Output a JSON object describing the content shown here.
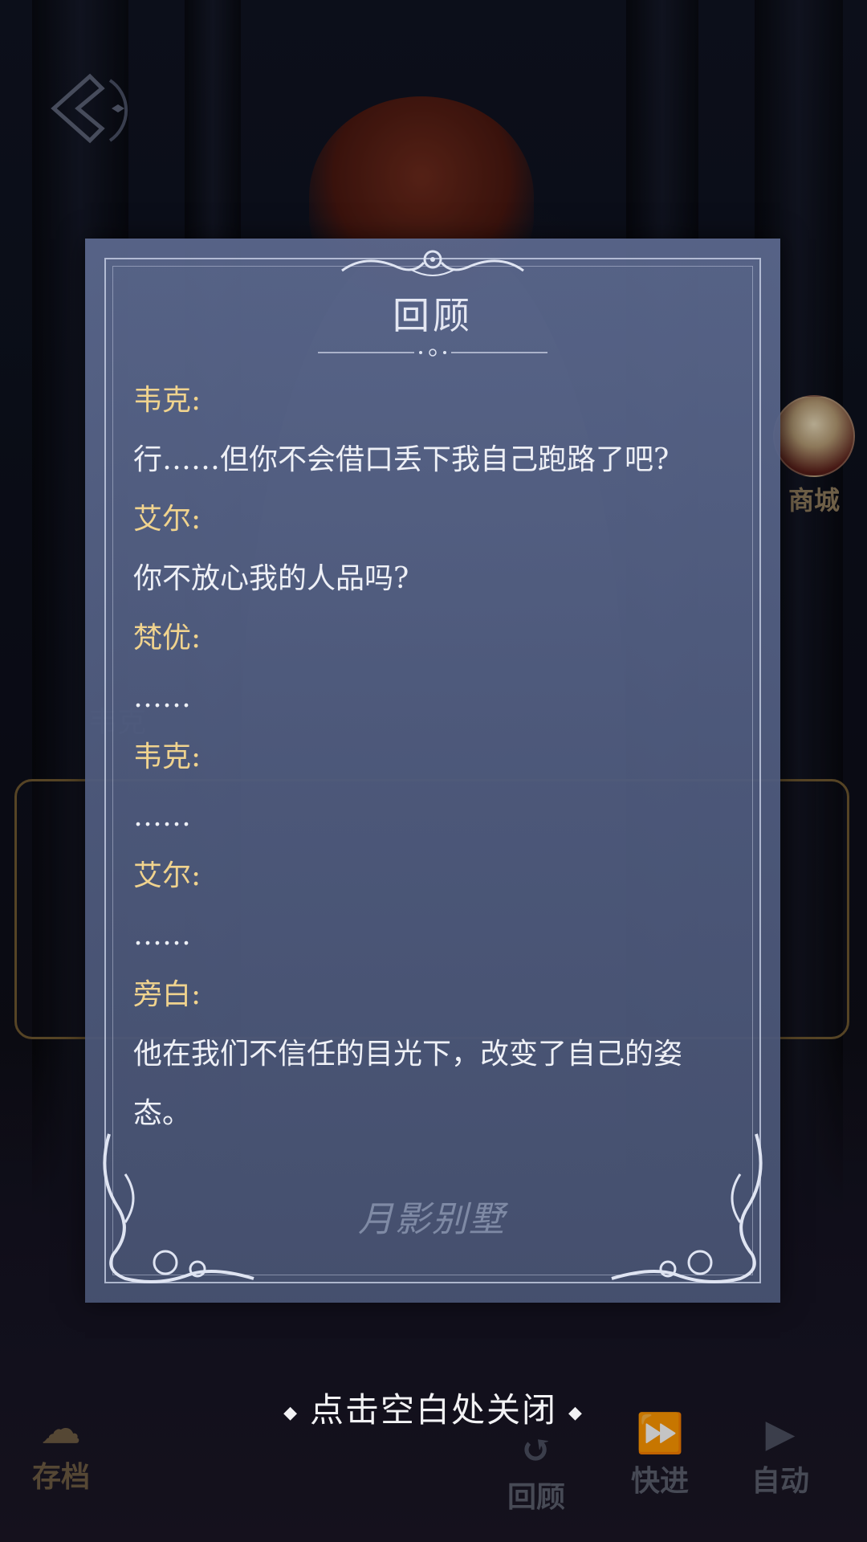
{
  "scene": {
    "shop_label": "商城"
  },
  "controls": {
    "save": "存档",
    "review": "回顾",
    "fast_forward": "快进",
    "auto": "自动"
  },
  "review_panel": {
    "title": "回顾",
    "watermark": "月影别墅",
    "entries": [
      {
        "speaker": "韦克:",
        "text": "行……但你不会借口丢下我自己跑路了吧?"
      },
      {
        "speaker": "艾尔:",
        "text": "你不放心我的人品吗?"
      },
      {
        "speaker": "梵优:",
        "text": "……"
      },
      {
        "speaker": "韦克:",
        "text": "……"
      },
      {
        "speaker": "艾尔:",
        "text": "……"
      },
      {
        "speaker": "旁白:",
        "text": "他在我们不信任的目光下，改变了自己的姿态。"
      }
    ]
  },
  "close_hint": "点击空白处关闭",
  "colors": {
    "speaker": "#f0d38e",
    "text": "#eef0f6",
    "panel": "#56638a"
  }
}
